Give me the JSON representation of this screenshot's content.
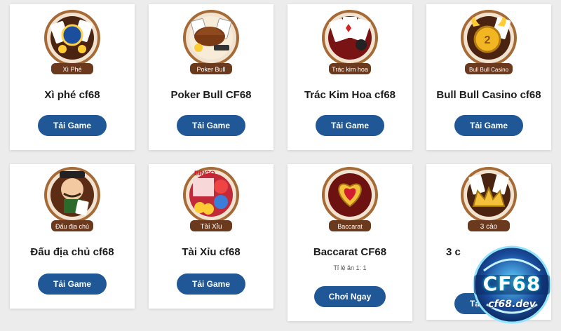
{
  "games": [
    {
      "title": "Xì phé cf68",
      "badge": "Xì Phé",
      "button": "Tải Game"
    },
    {
      "title": "Poker Bull CF68",
      "badge": "Poker Bull",
      "button": "Tải Game"
    },
    {
      "title": "Trác Kim Hoa cf68",
      "badge": "Trác kim hoa",
      "button": "Tải Game"
    },
    {
      "title": "Bull Bull Casino cf68",
      "badge": "Bull Bull Casino",
      "button": "Tải Game"
    },
    {
      "title": "Đấu địa chủ cf68",
      "badge": "Đấu địa chủ",
      "button": "Tải Game"
    },
    {
      "title": "Tài Xỉu cf68",
      "badge": "Tài Xỉu",
      "badge_top": "BINGO",
      "button": "Tải Game"
    },
    {
      "title": "Baccarat CF68",
      "badge": "Baccarat",
      "subtitle": "Tỉ lệ ăn 1: 1",
      "button": "Chơi Ngay"
    },
    {
      "title": "3 c",
      "badge": "3 cào",
      "button": "Tải Game"
    }
  ],
  "logo": {
    "brand": "CF68",
    "url": "cf68.dev"
  },
  "colors": {
    "button": "#1f5797",
    "badge_ring": "#6b3a1e",
    "card": "#ffffff",
    "background": "#ececec"
  }
}
